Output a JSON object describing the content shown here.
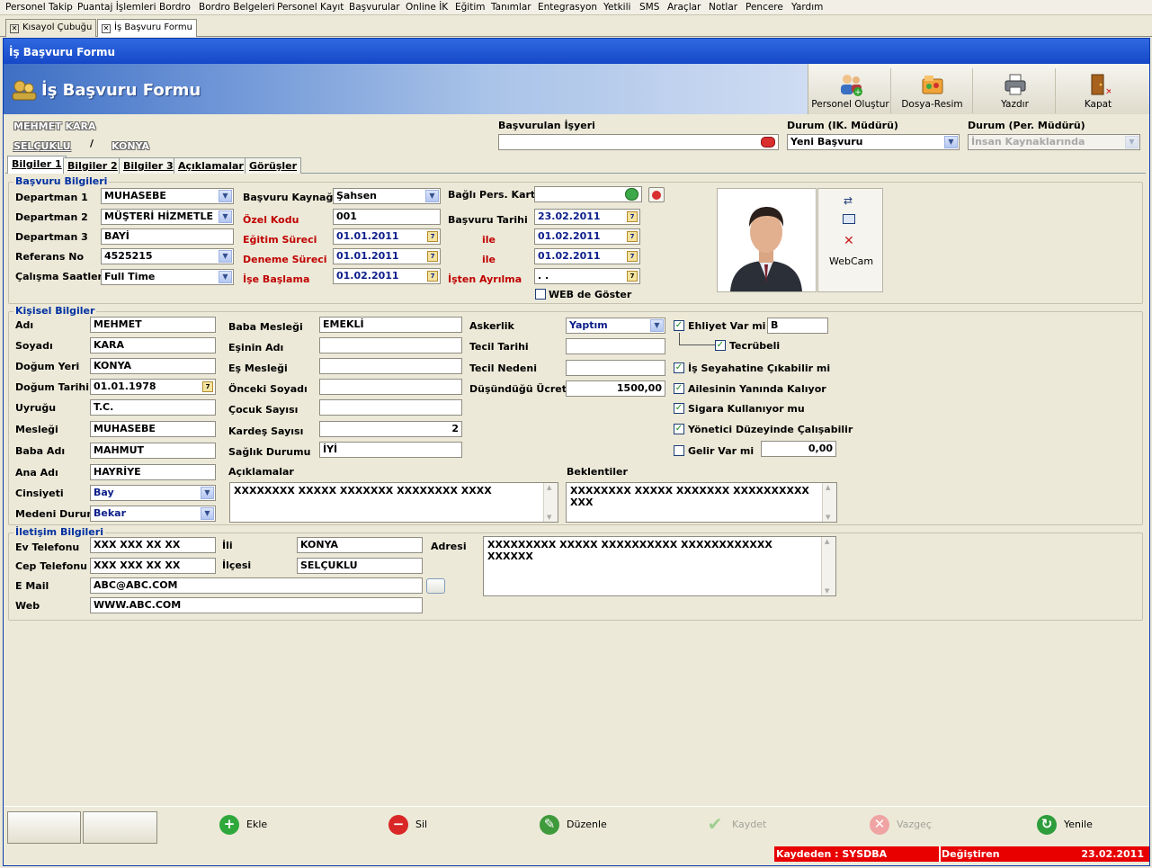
{
  "menu": [
    "Personel Takip",
    "Puantaj İşlemleri",
    "Bordro",
    "Bordro Belgeleri",
    "Personel Kayıt",
    "Başvurular",
    "Online İK",
    "Eğitim",
    "Tanımlar",
    "Entegrasyon",
    "Yetkili",
    "SMS",
    "Araçlar",
    "Notlar",
    "Pencere",
    "Yardım"
  ],
  "doc_tabs": [
    "Kısayol Çubuğu",
    "İş Başvuru Formu"
  ],
  "window_title": "İş Başvuru Formu",
  "banner_title": "İş Başvuru Formu",
  "toolbar": {
    "new_personnel": "Personel Oluştur",
    "file_image": "Dosya-Resim",
    "print": "Yazdır",
    "close": "Kapat"
  },
  "header": {
    "name": "MEHMET KARA",
    "district": "SELÇUKLU",
    "separator": "/",
    "city": "KONYA",
    "applied_workplace_label": "Başvurulan İşyeri",
    "applied_workplace_value": "",
    "status_ik_label": "Durum (IK. Müdürü)",
    "status_ik_value": "Yeni Başvuru",
    "status_per_label": "Durum (Per. Müdürü)",
    "status_per_value": "İnsan Kaynaklarında"
  },
  "page_tabs": [
    "Bilgiler 1",
    "Bilgiler 2",
    "Bilgiler 3",
    "Açıklamalar",
    "Görüşler"
  ],
  "basvuru": {
    "title": "Başvuru Bilgileri",
    "dept1_label": "Departman 1",
    "dept1": "MUHASEBE",
    "dept2_label": "Departman 2",
    "dept2": "MÜŞTERİ HİZMETLE",
    "dept3_label": "Departman 3",
    "dept3": "BAYİ",
    "ref_label": "Referans No",
    "ref": "4525215",
    "hours_label": "Çalışma Saatleri",
    "hours": "Full Time",
    "source_label": "Başvuru Kaynağı",
    "source": "Şahsen",
    "code_label": "Özel Kodu",
    "code": "001",
    "edu_label": "Eğitim Süreci",
    "edu_start": "01.01.2011",
    "edu_end": "01.02.2011",
    "trial_label": "Deneme Süreci",
    "trial_start": "01.01.2011",
    "trial_end": "01.02.2011",
    "start_label": "İşe Başlama",
    "start": "01.02.2011",
    "card_label": "Bağlı Pers. Kart",
    "card": "",
    "date_label": "Başvuru Tarihi",
    "date": "23.02.2011",
    "ile1": "ile",
    "ile2": "ile",
    "leave_label": "İşten Ayrılma",
    "leave": " .  .",
    "web_label": "WEB de Göster",
    "webcam": "WebCam"
  },
  "kisisel": {
    "title": "Kişisel Bilgiler",
    "name_label": "Adı",
    "name": "MEHMET",
    "surname_label": "Soyadı",
    "surname": "KARA",
    "birthplace_label": "Doğum Yeri",
    "birthplace": "KONYA",
    "birthdate_label": "Doğum Tarihi",
    "birthdate": "01.01.1978",
    "nationality_label": "Uyruğu",
    "nationality": "T.C.",
    "job_label": "Mesleği",
    "job": "MUHASEBE",
    "father_label": "Baba Adı",
    "father": "MAHMUT",
    "mother_label": "Ana Adı",
    "mother": "HAYRİYE",
    "gender_label": "Cinsiyeti",
    "gender": "Bay",
    "marital_label": "Medeni Durum",
    "marital": "Bekar",
    "father_job_label": "Baba Mesleği",
    "father_job": "EMEKLİ",
    "spouse_label": "Eşinin Adı",
    "spouse": "",
    "spouse_job_label": "Eş Mesleği",
    "spouse_job": "",
    "prev_surname_label": "Önceki Soyadı",
    "prev_surname": "",
    "children_label": "Çocuk Sayısı",
    "children": "",
    "siblings_label": "Kardeş Sayısı",
    "siblings": "2",
    "health_label": "Sağlık Durumu",
    "health": "İYİ",
    "military_label": "Askerlik",
    "military": "Yaptım",
    "discharge_date_label": "Tecil Tarihi",
    "discharge_date": "",
    "discharge_reason_label": "Tecil Nedeni",
    "discharge_reason": "",
    "salary_label": "Düşündüğü Ücret",
    "salary": "1500,00",
    "license_label": "Ehliyet Var mi",
    "license": "B",
    "experience_label": "Tecrübeli",
    "travel_label": "İş Seyahatine Çıkabilir mi",
    "family_label": "Ailesinin Yanında Kalıyor",
    "smoke_label": "Sigara Kullanıyor mu",
    "manager_label": "Yönetici Düzeyinde Çalışabilir",
    "income_label": "Gelir Var mi",
    "income": "0,00",
    "notes_label": "Açıklamalar",
    "notes": "XXXXXXXX XXXXX XXXXXXX XXXXXXXX XXXX",
    "expect_label": "Beklentiler",
    "expect": "XXXXXXXX XXXXX XXXXXXX XXXXXXXXXX XXX"
  },
  "iletisim": {
    "title": "İletişim Bilgileri",
    "home_label": "Ev Telefonu",
    "home": "XXX XXX XX XX",
    "mobile_label": "Cep Telefonu",
    "mobile": "XXX XXX XX XX",
    "email_label": "E Mail",
    "email": "ABC@ABC.COM",
    "web_label": "Web",
    "web": "WWW.ABC.COM",
    "city_label": "İli",
    "city": "KONYA",
    "district_label": "İlçesi",
    "district": "SELÇUKLU",
    "address_label": "Adresi",
    "address": "XXXXXXXXX XXXXX XXXXXXXXXX XXXXXXXXXXXX XXXXXX"
  },
  "actions": {
    "add": "Ekle",
    "delete": "Sil",
    "edit": "Düzenle",
    "save": "Kaydet",
    "cancel": "Vazgeç",
    "refresh": "Yenile"
  },
  "status": {
    "saved_by": "Kaydeden : SYSDBA",
    "changed": "Değiştiren",
    "date": "23.02.2011"
  }
}
